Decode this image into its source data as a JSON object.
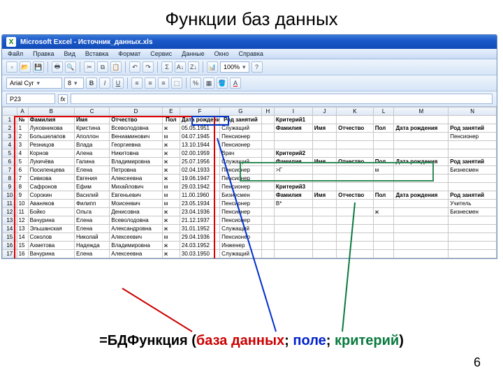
{
  "slide": {
    "title": "Функции баз данных",
    "page_number": "6"
  },
  "excel": {
    "titlebar": "Microsoft Excel - Источник_данных.xls",
    "menus": [
      "Файл",
      "Правка",
      "Вид",
      "Вставка",
      "Формат",
      "Сервис",
      "Данные",
      "Окно",
      "Справка"
    ],
    "font": {
      "name": "Arial Cyr",
      "size": "8",
      "zoom": "100%"
    },
    "namebox": "P23"
  },
  "columns": [
    "",
    "A",
    "B",
    "C",
    "D",
    "E",
    "F",
    "G",
    "H",
    "I",
    "J",
    "K",
    "L",
    "M",
    "N"
  ],
  "headers": {
    "num": "№",
    "fam": "Фамилия",
    "name": "Имя",
    "patr": "Отчество",
    "sex": "Пол",
    "dob": "Дата рождения",
    "occ": "Род занятий"
  },
  "rows": [
    {
      "n": "1",
      "f": "Луковникова",
      "i": "Кристина",
      "o": "Всеволодовна",
      "s": "ж",
      "d": "05.05.1951",
      "r": "Служащий"
    },
    {
      "n": "2",
      "f": "Большелапов",
      "i": "Аполлон",
      "o": "Вениаминович",
      "s": "м",
      "d": "04.07.1945",
      "r": "Пенсионер"
    },
    {
      "n": "3",
      "f": "Резницов",
      "i": "Влада",
      "o": "Георгиевна",
      "s": "ж",
      "d": "13.10.1944",
      "r": "Пенсионер"
    },
    {
      "n": "4",
      "f": "Корнов",
      "i": "Алена",
      "o": "Никитовна",
      "s": "ж",
      "d": "02.00.1959",
      "r": "Врач"
    },
    {
      "n": "5",
      "f": "Лукичёва",
      "i": "Галина",
      "o": "Владимировна",
      "s": "ж",
      "d": "25.07.1956",
      "r": "Служащий"
    },
    {
      "n": "6",
      "f": "Посиленцева",
      "i": "Елена",
      "o": "Петровна",
      "s": "ж",
      "d": "02.04.1933",
      "r": "Пенсионер"
    },
    {
      "n": "7",
      "f": "Сивкова",
      "i": "Евгения",
      "o": "Алексеевна",
      "s": "ж",
      "d": "19.06.1947",
      "r": "Пенсионер"
    },
    {
      "n": "8",
      "f": "Сафронов",
      "i": "Ефим",
      "o": "Михайлович",
      "s": "м",
      "d": "29.03.1942",
      "r": "Пенсионер"
    },
    {
      "n": "9",
      "f": "Сорокин",
      "i": "Василий",
      "o": "Евгеньевич",
      "s": "м",
      "d": "11.00.1960",
      "r": "Бизнесмен"
    },
    {
      "n": "10",
      "f": "Аваняков",
      "i": "Филипп",
      "o": "Моисеевич",
      "s": "м",
      "d": "23.05.1934",
      "r": "Пенсионер"
    },
    {
      "n": "11",
      "f": "Бойко",
      "i": "Ольга",
      "o": "Денисовна",
      "s": "ж",
      "d": "23.04.1936",
      "r": "Пенсионер"
    },
    {
      "n": "12",
      "f": "Вачурина",
      "i": "Елена",
      "o": "Всеволодовна",
      "s": "ж",
      "d": "21.12.1937",
      "r": "Пенсионер"
    },
    {
      "n": "13",
      "f": "Эльшанская",
      "i": "Елена",
      "o": "Александровна",
      "s": "ж",
      "d": "31.01.1952",
      "r": "Служащий"
    },
    {
      "n": "14",
      "f": "Соколов",
      "i": "Николай",
      "o": "Алексеевич",
      "s": "м",
      "d": "29.04.1936",
      "r": "Пенсионер"
    },
    {
      "n": "15",
      "f": "Ахметова",
      "i": "Надежда",
      "o": "Владимировна",
      "s": "ж",
      "d": "24.03.1952",
      "r": "Инженер"
    },
    {
      "n": "16",
      "f": "Вачурина",
      "i": "Елена",
      "o": "Алексеевна",
      "s": "ж",
      "d": "30.03.1950",
      "r": "Служащий"
    }
  ],
  "criteria1": {
    "label": "Критерий1",
    "headers": [
      "Фамилия",
      "Имя",
      "Отчество",
      "Пол",
      "Дата рождения",
      "Род занятий"
    ],
    "row": [
      "",
      "",
      "",
      "",
      "",
      "Пенсионер"
    ]
  },
  "criteria2": {
    "label": "Критерий2",
    "headers": [
      "Фамилия",
      "Имя",
      "Отчество",
      "Пол",
      "Дата рождения",
      "Род занятий"
    ],
    "row": [
      ">Г",
      "",
      "",
      "м",
      "",
      "Бизнесмен"
    ]
  },
  "criteria3": {
    "label": "Критерий3",
    "headers": [
      "Фамилия",
      "Имя",
      "Отчество",
      "Пол",
      "Дата рождения",
      "Род занятий"
    ],
    "rows": [
      [
        "В*",
        "",
        "",
        "",
        "",
        "Учитель"
      ],
      [
        "",
        "",
        "",
        "ж",
        "",
        "Бизнесмен"
      ]
    ]
  },
  "formula": {
    "eq": "=БДФункция (",
    "a": "база данных",
    "sep1": "; ",
    "b": "поле",
    "sep2": "; ",
    "c": "критерий",
    "close": ")"
  }
}
